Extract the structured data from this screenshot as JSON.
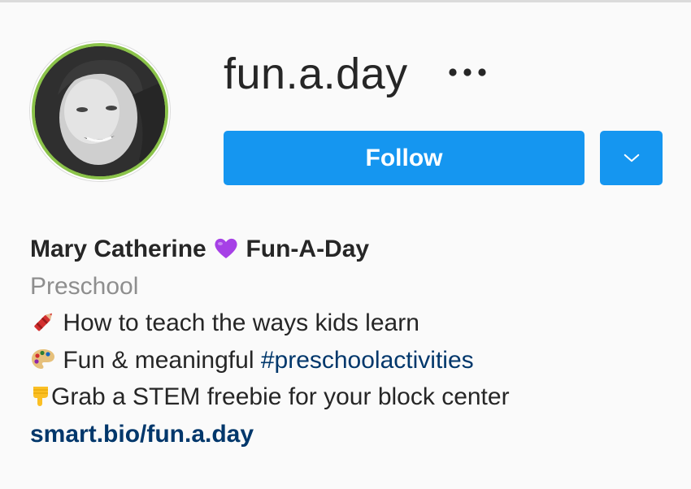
{
  "profile": {
    "username": "fun.a.day",
    "follow_label": "Follow",
    "full_name_first": "Mary Catherine",
    "full_name_second": "Fun-A-Day",
    "category": "Preschool",
    "bio_line_1": "How to teach the ways kids learn",
    "bio_line_2_text": "Fun & meaningful",
    "bio_line_2_hashtag": "#preschoolactivities",
    "bio_line_3": "Grab a STEM freebie for your block center",
    "link": "smart.bio/fun.a.day"
  },
  "icons": {
    "more": "more-horizontal-icon",
    "dropdown": "chevron-down-icon",
    "heart": "purple-heart-icon",
    "crayon": "crayon-icon",
    "palette": "palette-icon",
    "pointing": "pointing-down-icon"
  },
  "colors": {
    "accent": "#1596f0",
    "link": "#00376b",
    "muted": "#8e8e8e",
    "text": "#262626",
    "avatar_ring": "#8bc34a",
    "heart": "#a640e6"
  }
}
